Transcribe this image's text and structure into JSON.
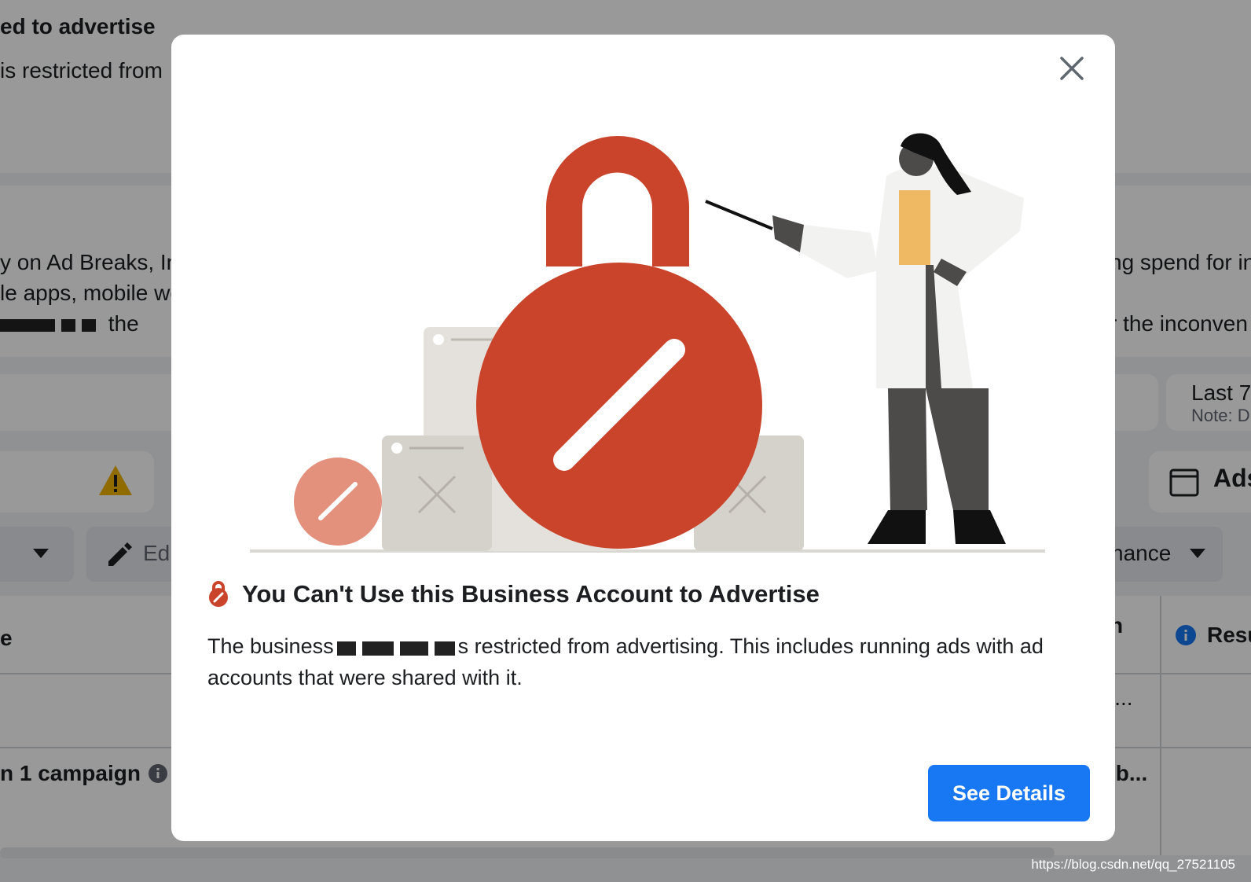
{
  "background": {
    "header_title": "ed to advertise",
    "header_sub": "is restricted from",
    "notice_line1_left": "y on Ad Breaks, Ins",
    "notice_line2_left": "le apps, mobile we",
    "notice_line3_left": "the",
    "notice_line1_right": "ng spend for in",
    "notice_line3_right": "r the inconven",
    "date_range_label": "Last 7",
    "date_note": "Note: D",
    "ads_tab_label": "Ads",
    "edit_button_label": "Edi",
    "performance_dropdown_label": "nance",
    "column_right_label": "Resu",
    "column_mid_label": "n",
    "row_campaign_label": "n 1 campaign",
    "row_right_1": "i...",
    "row_right_2": "ib...",
    "row_left_1": "e"
  },
  "modal": {
    "title": "You Can't Use this Business Account to Advertise",
    "body_prefix": "The business",
    "body_suffix": "s restricted from advertising. This includes running ads with ad accounts that were shared with it.",
    "primary_button": "See Details"
  },
  "watermark": "https://blog.csdn.net/qq_27521105",
  "colors": {
    "accent": "#1877f2",
    "lock_red": "#c9442a",
    "warning": "#f0b400"
  },
  "icons": {
    "close": "close-icon",
    "title": "lock-icon",
    "warning": "warning-icon",
    "info": "info-icon",
    "edit": "pencil-icon",
    "ads": "ads-window-icon"
  }
}
